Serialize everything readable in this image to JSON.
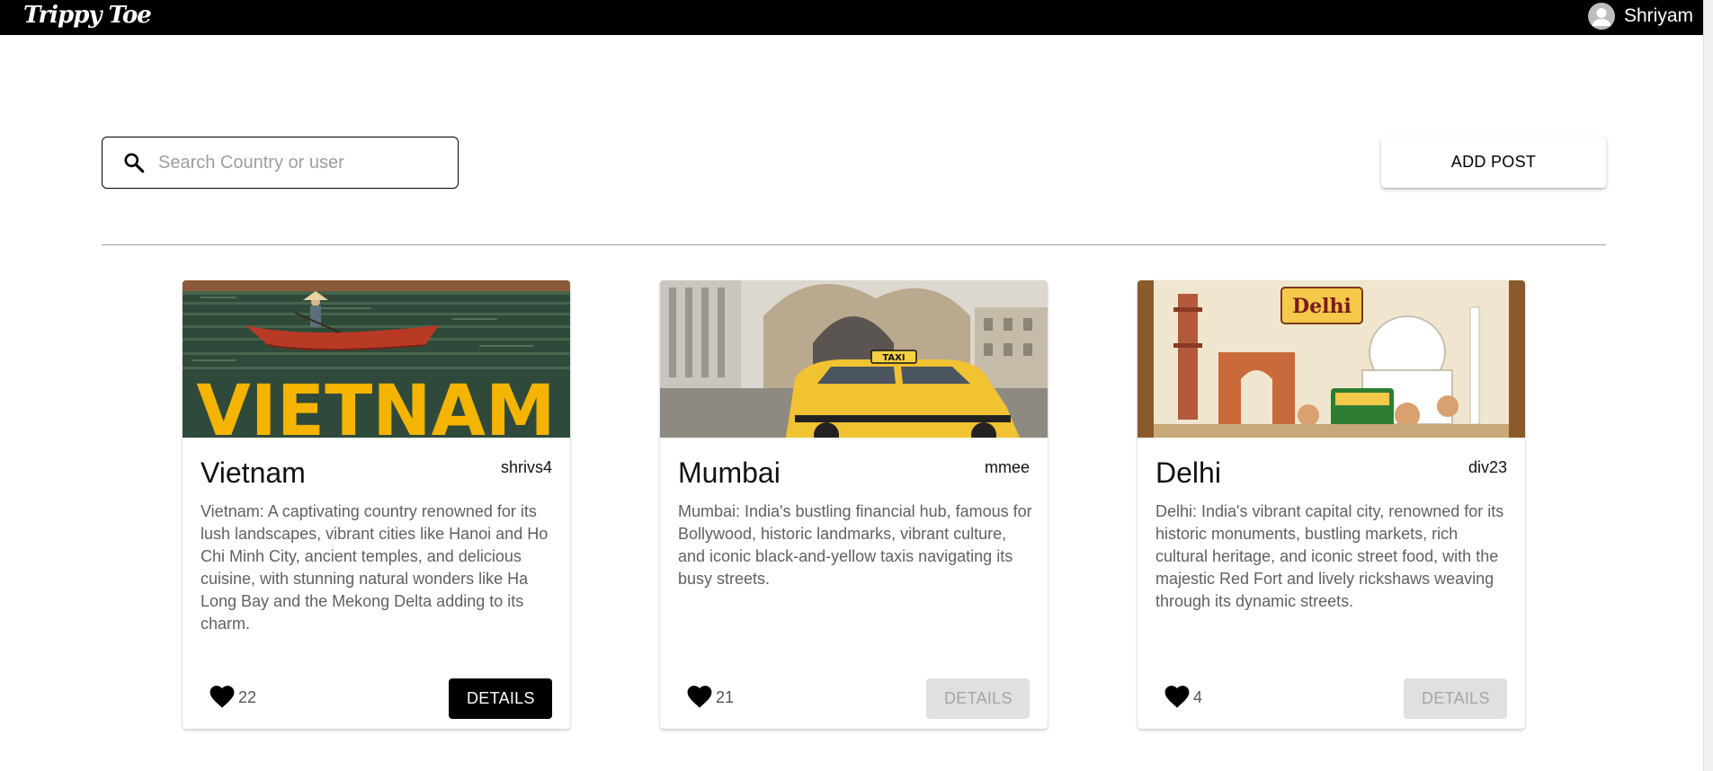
{
  "header": {
    "logo": "Trippy Toe",
    "username": "Shriyam"
  },
  "search": {
    "placeholder": "Search Country or user",
    "value": ""
  },
  "toolbar": {
    "add_post_label": "ADD POST"
  },
  "posts": [
    {
      "title": "Vietnam",
      "user": "shrivs4",
      "description": "Vietnam: A captivating country renowned for its lush landscapes, vibrant cities like Hanoi and Ho Chi Minh City, ancient temples, and delicious cuisine, with stunning natural wonders like Ha Long Bay and the Mekong Delta adding to its charm.",
      "likes": "22",
      "details_label": "DETAILS",
      "image_text": "VIETNAM"
    },
    {
      "title": "Mumbai",
      "user": "mmee",
      "description": "Mumbai: India's bustling financial hub, famous for Bollywood, historic landmarks, vibrant culture, and iconic black-and-yellow taxis navigating its busy streets.",
      "likes": "21",
      "details_label": "DETAILS",
      "image_text": "TAXI"
    },
    {
      "title": "Delhi",
      "user": "div23",
      "description": "Delhi: India's vibrant capital city, renowned for its historic monuments, bustling markets, rich cultural heritage, and iconic street food, with the majestic Red Fort and lively rickshaws weaving through its dynamic streets.",
      "likes": "4",
      "details_label": "DETAILS",
      "image_text": "Delhi"
    }
  ],
  "colors": {
    "header_bg": "#000000",
    "vietnam_yellow": "#f4b400",
    "taxi_yellow": "#f1c232",
    "delhi_orange": "#e8a33b"
  }
}
